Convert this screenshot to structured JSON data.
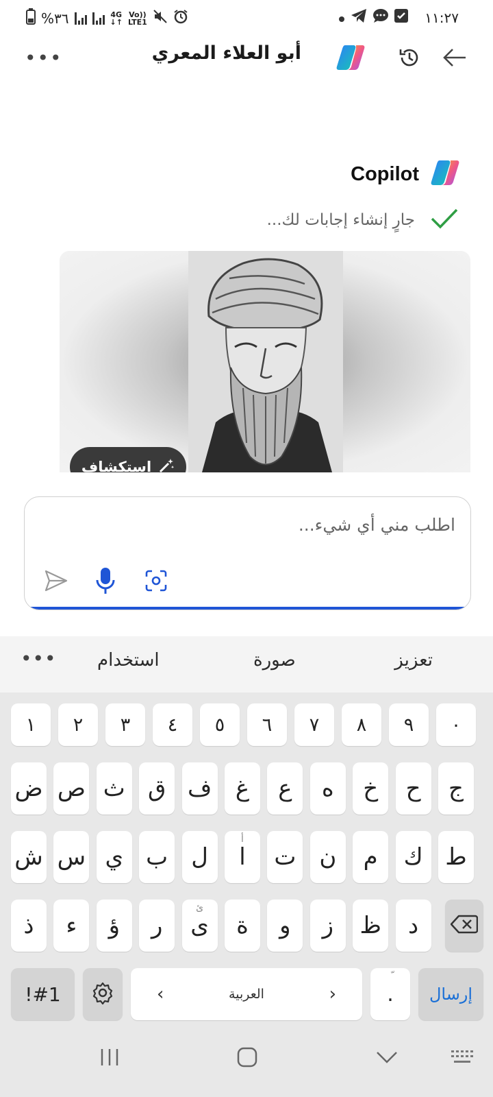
{
  "status_bar": {
    "time": "١١:٢٧",
    "battery": "%٣٦",
    "network_top": "4G",
    "network_bottom": "↓↑",
    "volte_top": "Vo))",
    "volte_bottom": "LTE1"
  },
  "header": {
    "title": "أبو العلاء المعري"
  },
  "chat": {
    "sender": "Copilot",
    "progress_text": "جارٍ إنشاء إجابات لك...",
    "explore_label": "استكشاف"
  },
  "input": {
    "placeholder": "اطلب مني أي شيء..."
  },
  "suggestions": [
    "تعزيز",
    "صورة",
    "استخدام"
  ],
  "keyboard": {
    "numbers": [
      "١",
      "٢",
      "٣",
      "٤",
      "٥",
      "٦",
      "٧",
      "٨",
      "٩",
      "٠"
    ],
    "row1": [
      "ض",
      "ص",
      "ث",
      "ق",
      "ف",
      "غ",
      "ع",
      "ه",
      "خ",
      "ح",
      "ج"
    ],
    "row2": [
      "ش",
      "س",
      "ي",
      "ب",
      "ل",
      "ا",
      "ت",
      "ن",
      "م",
      "ك",
      "ط"
    ],
    "row3": [
      "ذ",
      "ء",
      "ؤ",
      "ر",
      "ى",
      "ة",
      "و",
      "ز",
      "ظ",
      "د"
    ],
    "row2_alef_hint": "أ",
    "row3_ya_hint": "ئ",
    "symbols_key": "!#1",
    "space_label": "العربية",
    "period": ".",
    "period_hint": "ّ",
    "send_label": "إرسال"
  },
  "colors": {
    "accent": "#1f55d6",
    "check": "#2f9e44",
    "send_text": "#1a6fd6"
  }
}
